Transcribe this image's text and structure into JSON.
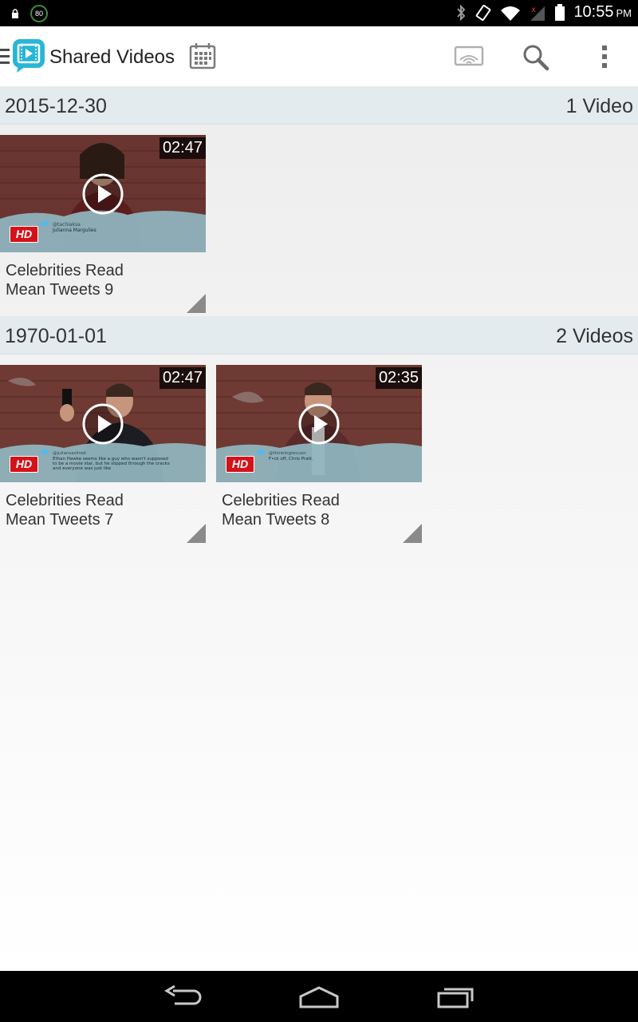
{
  "status_bar": {
    "badge": "80",
    "time": "10:55",
    "ampm": "PM"
  },
  "action_bar": {
    "title": "Shared Videos",
    "icons": [
      "menu-icon",
      "app-logo-icon",
      "calendar-icon",
      "cast-icon",
      "search-icon",
      "overflow-menu-icon"
    ]
  },
  "sections": [
    {
      "date": "2015-12-30",
      "count": "1 Video",
      "videos": [
        {
          "title_line1": "Celebrities Read",
          "title_line2": "Mean Tweets 9",
          "duration": "02:47",
          "hd": "HD"
        }
      ]
    },
    {
      "date": "1970-01-01",
      "count": "2 Videos",
      "videos": [
        {
          "title_line1": "Celebrities Read",
          "title_line2": "Mean Tweets 7",
          "duration": "02:47",
          "hd": "HD"
        },
        {
          "title_line1": "Celebrities Read",
          "title_line2": "Mean Tweets 8",
          "duration": "02:35",
          "hd": "HD"
        }
      ]
    }
  ],
  "colors": {
    "accent": "#29b6d6",
    "section_bg": "#e4ebef",
    "hd_badge": "#d41219"
  }
}
